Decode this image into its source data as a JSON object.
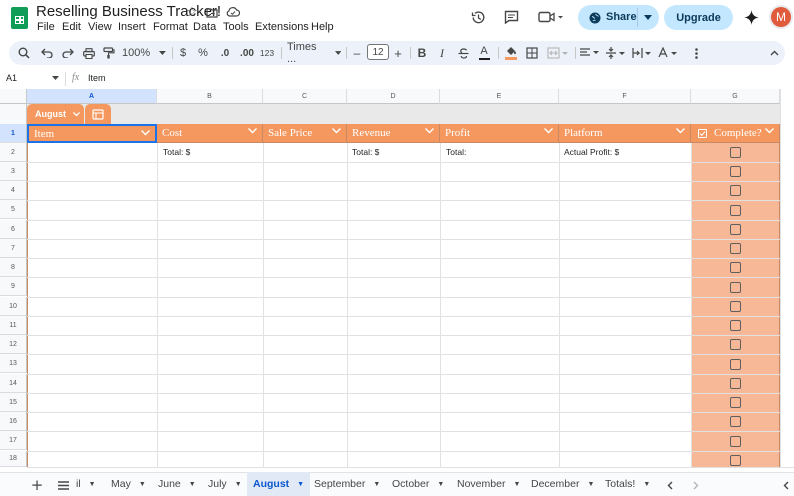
{
  "document": {
    "title": "Reselling Business Tracker!"
  },
  "menu": [
    "File",
    "Edit",
    "View",
    "Insert",
    "Format",
    "Data",
    "Tools",
    "Extensions",
    "Help"
  ],
  "header": {
    "share_label": "Share",
    "upgrade_label": "Upgrade",
    "avatar_initial": "M"
  },
  "toolbar": {
    "zoom": "100%",
    "currency": "$",
    "percent": "%",
    "dec_decrease": ".0",
    "dec_increase": ".00",
    "number_format": "123",
    "font_name": "Times ...",
    "font_size": "12",
    "bold": "B",
    "italic": "I",
    "text_color_letter": "A",
    "minus": "–",
    "plus": "+"
  },
  "formula": {
    "cell_ref": "A1",
    "fx": "fx",
    "content": "Item"
  },
  "columns": [
    "A",
    "B",
    "C",
    "D",
    "E",
    "F",
    "G"
  ],
  "rows": [
    "1",
    "2",
    "3",
    "4",
    "5",
    "6",
    "7",
    "8",
    "9",
    "10",
    "11",
    "12",
    "13",
    "14",
    "15",
    "16",
    "17",
    "18"
  ],
  "group": {
    "label": "August"
  },
  "table": {
    "headers": [
      "Item",
      "Cost",
      "Sale Price",
      "Revenue",
      "Profit",
      "Platform",
      "Complete?"
    ],
    "row2": {
      "cost": "Total: $",
      "revenue": "Total: $",
      "profit": "Total:",
      "platform": "Actual Profit: $"
    },
    "header_color": "#f4985f",
    "complete_column_color": "#f7b897"
  },
  "sheets": {
    "tabs": [
      "il",
      "May",
      "June",
      "July",
      "August",
      "September",
      "October",
      "November",
      "December",
      "Totals!"
    ],
    "active": "August"
  }
}
